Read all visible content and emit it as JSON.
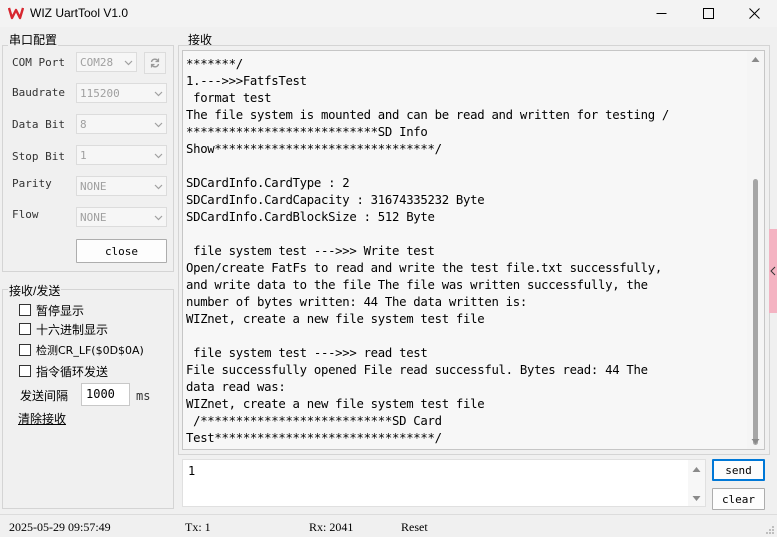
{
  "window": {
    "title": "WIZ UartTool V1.0",
    "logo_color": "#d7272f",
    "accent": "#0078d7"
  },
  "serial_config": {
    "group_title": "串口配置",
    "com_port": {
      "label": "COM Port",
      "value": "COM28"
    },
    "baudrate": {
      "label": "Baudrate",
      "value": "115200"
    },
    "data_bit": {
      "label": "Data Bit",
      "value": "8"
    },
    "stop_bit": {
      "label": "Stop Bit",
      "value": "1"
    },
    "parity": {
      "label": "Parity",
      "value": "NONE"
    },
    "flow": {
      "label": "Flow",
      "value": "NONE"
    },
    "close_label": "close"
  },
  "rx_tx": {
    "group_title": "接收/发送",
    "options": [
      {
        "label": "暂停显示",
        "checked": false
      },
      {
        "label": "十六进制显示",
        "checked": false
      },
      {
        "label": "检测CR_LF($0D$0A)",
        "checked": false
      },
      {
        "label": "指令循环发送",
        "checked": false
      }
    ],
    "interval_label": "发送间隔",
    "interval_value": "1000",
    "interval_unit": "ms",
    "clear_receive_label": "清除接收"
  },
  "receive": {
    "group_title": "接收",
    "text": "*******/\n1.--->>>FatfsTest\n format test\nThe file system is mounted and can be read and written for testing /\n***************************SD Info\nShow*******************************/\n\nSDCardInfo.CardType : 2\nSDCardInfo.CardCapacity : 31674335232 Byte\nSDCardInfo.CardBlockSize : 512 Byte\n\n file system test --->>> Write test\nOpen/create FatFs to read and write the test file.txt successfully,\nand write data to the file The file was written successfully, the\nnumber of bytes written: 44 The data written is:\nWIZnet, create a new file system test file\n\n file system test --->>> read test\nFile successfully opened File read successful. Bytes read: 44 The\ndata read was:\nWIZnet, create a new file system test file\n /***************************SD Card\nTest*******************************/"
  },
  "send": {
    "input_value": "1",
    "send_label": "send",
    "clear_label": "clear"
  },
  "status": {
    "datetime": "2025-05-29 09:57:49",
    "tx": "Tx: 1",
    "rx": "Rx: 2041",
    "reset_label": "Reset"
  }
}
